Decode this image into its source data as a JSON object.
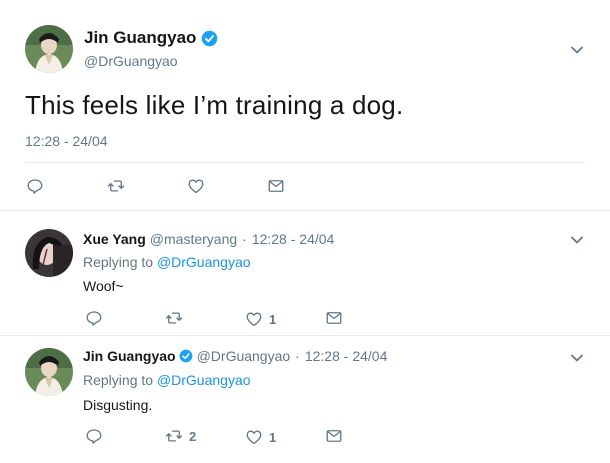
{
  "main_tweet": {
    "author_name": "Jin Guangyao",
    "author_handle": "@DrGuangyao",
    "verified": true,
    "text": "This feels like I’m training a dog.",
    "timestamp": "12:28 - 24/04",
    "actions": [
      "reply-icon",
      "retweet-icon",
      "like-icon",
      "message-icon"
    ]
  },
  "replies": [
    {
      "author_name": "Xue Yang",
      "author_handle": "@masteryang",
      "verified": false,
      "separator": "·",
      "timestamp": "12:28 - 24/04",
      "replying_prefix": "Replying to",
      "replying_to": "@DrGuangyao",
      "text": "Woof~",
      "retweet_count": "",
      "like_count": "1"
    },
    {
      "author_name": "Jin Guangyao",
      "author_handle": "@DrGuangyao",
      "verified": true,
      "separator": "·",
      "timestamp": "12:28 - 24/04",
      "replying_prefix": "Replying to",
      "replying_to": "@DrGuangyao",
      "text": "Disgusting.",
      "retweet_count": "2",
      "like_count": "1"
    }
  ],
  "colors": {
    "text": "#14171a",
    "secondary": "#657786",
    "link": "#1b95e0",
    "verified": "#1da1f2",
    "divider": "#e6ecf0"
  }
}
